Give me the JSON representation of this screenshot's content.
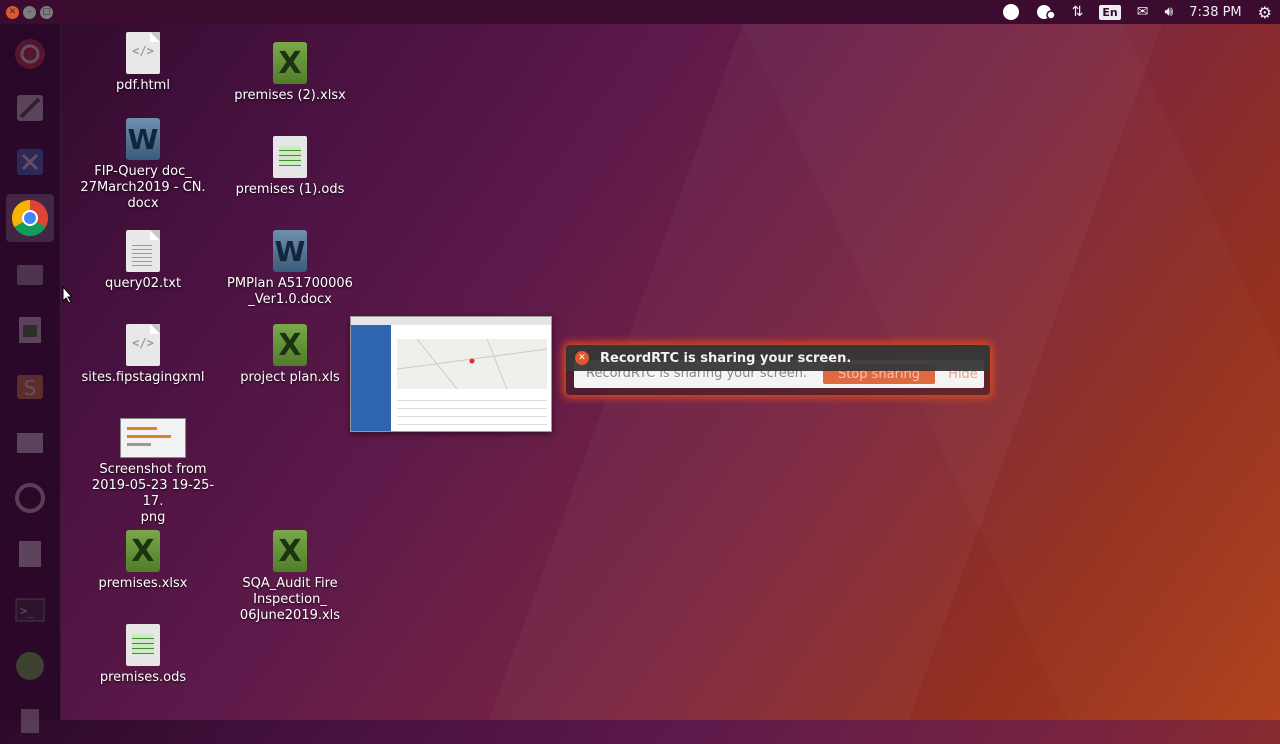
{
  "top_panel": {
    "keyboard_layout": "En",
    "clock": "7:38 PM"
  },
  "desktop": {
    "icons": [
      {
        "label": "pdf.html",
        "type": "html"
      },
      {
        "label": "FIP-Query doc_\n27March2019 - CN.\ndocx",
        "type": "docx"
      },
      {
        "label": "query02.txt",
        "type": "txt"
      },
      {
        "label": "sites.fipstagingxml",
        "type": "xml"
      },
      {
        "label": "Screenshot from\n2019-05-23 19-25-17.\npng",
        "type": "png"
      },
      {
        "label": "premises.xlsx",
        "type": "xlsx"
      },
      {
        "label": "premises.ods",
        "type": "ods"
      },
      {
        "label": "premises (2).xlsx",
        "type": "xlsx"
      },
      {
        "label": "premises (1).ods",
        "type": "ods"
      },
      {
        "label": "PMPlan A51700006\n_Ver1.0.docx",
        "type": "docx"
      },
      {
        "label": "project plan.xls",
        "type": "xls"
      },
      {
        "label": "SQA_Audit Fire\nInspection_\n06June2019.xls",
        "type": "xls"
      }
    ]
  },
  "notification": {
    "title": "RecordRTC is sharing your screen.",
    "bar_text": "RecordRTC is sharing your screen.",
    "stop_label": "Stop sharing",
    "hide_label": "Hide"
  },
  "colors": {
    "panel": "#3b0c2f",
    "accent": "#d94a1e",
    "close": "#e2552d"
  }
}
